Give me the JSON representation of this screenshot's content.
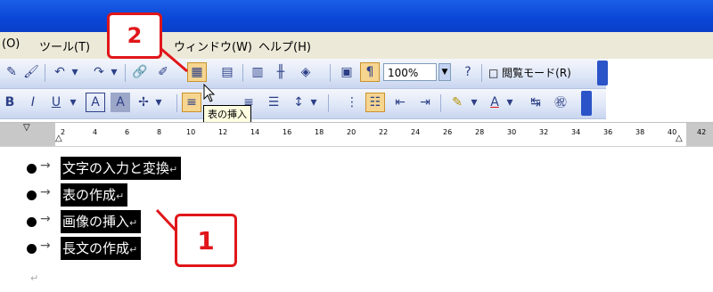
{
  "menus": [
    "(O)",
    "ツール(T)",
    "ウィンドウ(W)",
    "ヘルプ(H)"
  ],
  "toolbar1": {
    "zoom": "100%",
    "reading_mode": "閲覧モード(R)",
    "insert_table_tooltip": "表の挿入"
  },
  "toolbar2": {
    "bold": "B",
    "italic": "I",
    "underline": "U",
    "char_border": "A",
    "char_shading": "A"
  },
  "ruler": {
    "ticks": [
      "2",
      "4",
      "6",
      "8",
      "10",
      "12",
      "14",
      "16",
      "18",
      "20",
      "22",
      "24",
      "26",
      "28",
      "30",
      "32",
      "34",
      "36",
      "38",
      "40",
      "42"
    ]
  },
  "document": {
    "lines": [
      {
        "text": "文字の入力と変換",
        "mark": "↵"
      },
      {
        "text": "表の作成",
        "mark": "↵"
      },
      {
        "text": "画像の挿入",
        "mark": "↵"
      },
      {
        "text": "長文の作成",
        "mark": "↵"
      }
    ],
    "empty_mark": "↵"
  },
  "callouts": {
    "one": "1",
    "two": "2"
  },
  "colors": {
    "accent": "#e0161a",
    "title_bar": "#0a46d6",
    "selection": "#000000"
  }
}
